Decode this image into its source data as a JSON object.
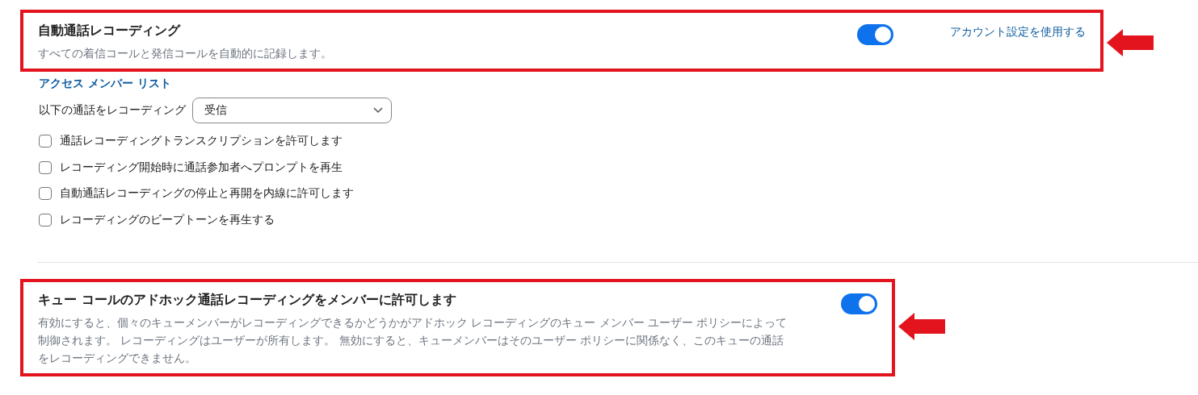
{
  "auto_recording": {
    "title": "自動通話レコーディング",
    "description": "すべての着信コールと発信コールを自動的に記録します。",
    "on": true,
    "link": "アカウント設定を使用する"
  },
  "access_member_list": "アクセス メンバー リスト",
  "record_calls": {
    "label": "以下の通話をレコーディング",
    "value": "受信"
  },
  "options": [
    {
      "label": "通話レコーディングトランスクリプションを許可します",
      "checked": false
    },
    {
      "label": "レコーディング開始時に通話参加者へプロンプトを再生",
      "checked": false
    },
    {
      "label": "自動通話レコーディングの停止と再開を内線に許可します",
      "checked": false
    },
    {
      "label": "レコーディングのビープトーンを再生する",
      "checked": false
    }
  ],
  "adhoc_recording": {
    "title": "キュー コールのアドホック通話レコーディングをメンバーに許可します",
    "description": "有効にすると、個々のキューメンバーがレコーディングできるかどうかがアドホック レコーディングのキュー メンバー ユーザー ポリシーによって制御されます。 レコーディングはユーザーが所有します。 無効にすると、キューメンバーはそのユーザー ポリシーに関係なく、このキューの通話をレコーディングできません。",
    "on": true
  }
}
